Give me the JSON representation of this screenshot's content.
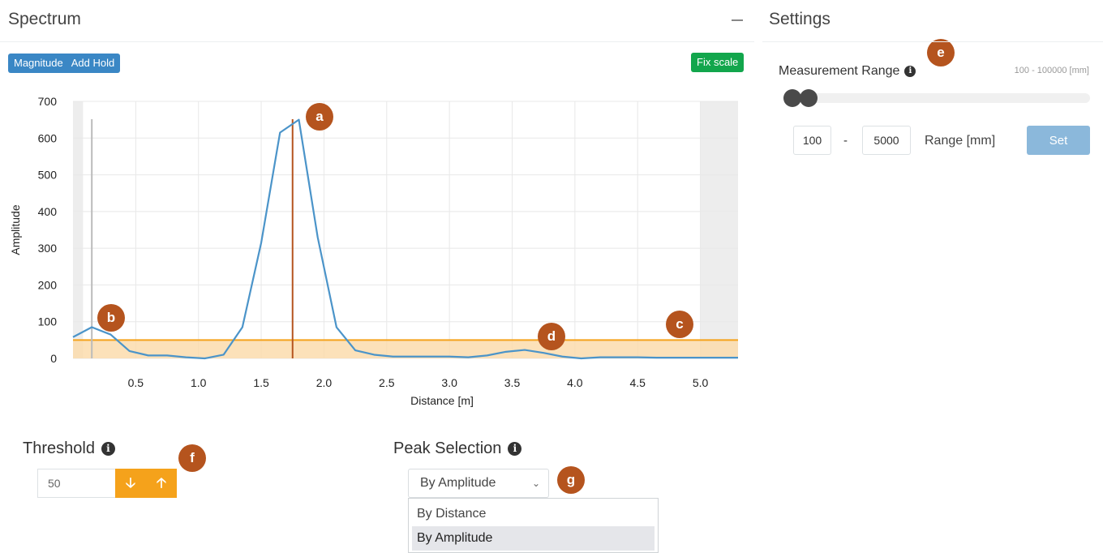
{
  "spectrum": {
    "title": "Spectrum",
    "mode_button": "Magnitude",
    "add_hold_button": "Add Hold",
    "fix_scale_button": "Fix scale"
  },
  "settings": {
    "title": "Settings",
    "measurement_range_label": "Measurement Range",
    "range_hint": "100 - 100000 [mm]",
    "range_min": "100",
    "range_dash": "-",
    "range_max": "5000",
    "range_unit_label": "Range [mm]",
    "set_button": "Set"
  },
  "threshold": {
    "label": "Threshold",
    "value": "50"
  },
  "peak_selection": {
    "label": "Peak Selection",
    "selected": "By Amplitude",
    "options": [
      "By Distance",
      "By Amplitude"
    ]
  },
  "badges": {
    "a": "a",
    "b": "b",
    "c": "c",
    "d": "d",
    "e": "e",
    "f": "f",
    "g": "g"
  },
  "colors": {
    "line": "#4b94c9",
    "threshold": "#f5a21b",
    "threshold_fill": "#fbd9a8",
    "peak_marker": "#b5541e",
    "badge": "#b5541e",
    "blue_button": "#3a87c5",
    "green_button": "#12a64c"
  },
  "chart_data": {
    "type": "line",
    "xlabel": "Distance [m]",
    "ylabel": "Amplitude",
    "xlim": [
      0.0,
      5.3
    ],
    "ylim": [
      0,
      700
    ],
    "x_ticks": [
      "0.5",
      "1.0",
      "1.5",
      "2.0",
      "2.5",
      "3.0",
      "3.5",
      "4.0",
      "4.5",
      "5.0"
    ],
    "y_ticks": [
      "0",
      "100",
      "200",
      "300",
      "400",
      "500",
      "600",
      "700"
    ],
    "grid": true,
    "series": [
      {
        "x": [
          0.0,
          0.15,
          0.3,
          0.45,
          0.6,
          0.75,
          0.9,
          1.05,
          1.2,
          1.35,
          1.5,
          1.65,
          1.8,
          1.95,
          2.1,
          2.25,
          2.4,
          2.55,
          2.7,
          2.85,
          3.0,
          3.15,
          3.3,
          3.45,
          3.6,
          3.75,
          3.9,
          4.05,
          4.2,
          4.35,
          4.5,
          4.65,
          4.8,
          4.95,
          5.1,
          5.3
        ],
        "y": [
          58,
          85,
          65,
          20,
          8,
          8,
          3,
          0,
          10,
          85,
          315,
          615,
          650,
          330,
          85,
          22,
          10,
          5,
          5,
          5,
          5,
          3,
          8,
          18,
          23,
          15,
          5,
          0,
          3,
          3,
          3,
          2,
          2,
          2,
          2,
          2
        ]
      }
    ],
    "threshold": 50,
    "peak_marker_x": 1.75,
    "left_marker_x": 0.15,
    "excluded_x_ranges": [
      [
        0.0,
        0.08
      ],
      [
        5.0,
        5.3
      ]
    ]
  }
}
